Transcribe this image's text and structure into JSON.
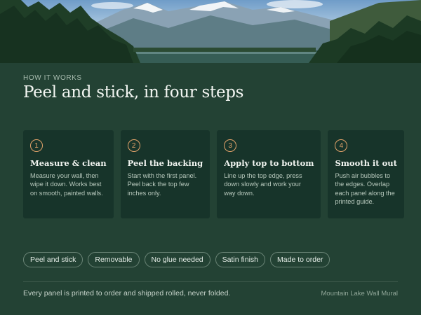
{
  "hero": {
    "icon": "mountain-lake-scene"
  },
  "header": {
    "eyebrow": "HOW IT WORKS",
    "title": "Peel and stick, in four steps"
  },
  "steps": [
    {
      "number": "1",
      "title": "Measure & clean",
      "body": "Measure your wall, then wipe it down. Works best on smooth, painted walls."
    },
    {
      "number": "2",
      "title": "Peel the backing",
      "body": "Start with the first panel. Peel back the top few inches only."
    },
    {
      "number": "3",
      "title": "Apply top to bottom",
      "body": "Line up the top edge, press down slowly and work your way down."
    },
    {
      "number": "4",
      "title": "Smooth it out",
      "body": "Push air bubbles to the edges. Overlap each panel along the printed guide."
    }
  ],
  "tags": [
    "Peel and stick",
    "Removable",
    "No glue needed",
    "Satin finish",
    "Made to order"
  ],
  "footer": {
    "note": "Every panel is printed to order and shipped rolled, never folded.",
    "product": "Mountain Lake Wall Mural"
  },
  "colors": {
    "background": "#234234",
    "card": "#17342a",
    "accent": "#e2a36a"
  }
}
